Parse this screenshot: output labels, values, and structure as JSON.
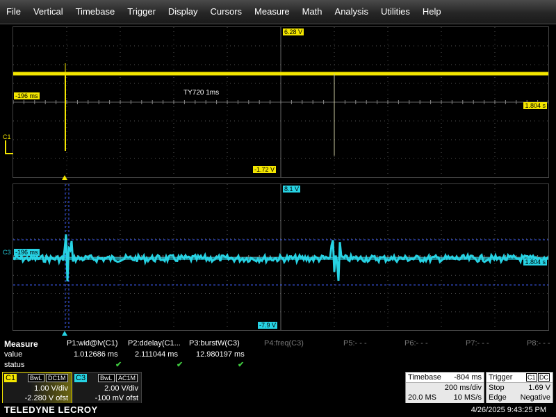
{
  "menu": [
    "File",
    "Vertical",
    "Timebase",
    "Trigger",
    "Display",
    "Cursors",
    "Measure",
    "Math",
    "Analysis",
    "Utilities",
    "Help"
  ],
  "grid1": {
    "top_label": "6.28 V",
    "bottom_label": "-1.72 V",
    "left_label": "-196 ms",
    "right_label": "1.804 s",
    "channel_marker": "C1",
    "annotation": "TY720 1ms",
    "trace_color": "#f4e600"
  },
  "grid2": {
    "top_label": "8.1 V",
    "bottom_label": "-7.9 V",
    "left_label": "-196 ms",
    "right_label": "1.804 s",
    "channel_marker": "C3",
    "trace_color": "#27d3e4"
  },
  "measure": {
    "title": "Measure",
    "row_value": "value",
    "row_status": "status",
    "params": [
      {
        "name": "P1:wid@lv(C1)",
        "value": "1.012686 ms",
        "status": "✔",
        "active": true
      },
      {
        "name": "P2:ddelay(C1...",
        "value": "2.111044 ms",
        "status": "✔",
        "active": true
      },
      {
        "name": "P3:burstW(C3)",
        "value": "12.980197 ms",
        "status": "✔",
        "active": true
      },
      {
        "name": "P4:freq(C3)",
        "value": "",
        "status": "",
        "active": false
      },
      {
        "name": "P5:- - -",
        "value": "",
        "status": "",
        "active": false
      },
      {
        "name": "P6:- - -",
        "value": "",
        "status": "",
        "active": false
      },
      {
        "name": "P7:- - -",
        "value": "",
        "status": "",
        "active": false
      },
      {
        "name": "P8:- - -",
        "value": "",
        "status": "",
        "active": false
      }
    ]
  },
  "c1": {
    "tag": "C1",
    "bw": "BwL",
    "coupling": "DC1M",
    "vdiv": "1.00 V/div",
    "offset": "-2.280 V ofst",
    "color": "#f4e600"
  },
  "c3": {
    "tag": "C3",
    "bw": "BwL",
    "coupling": "AC1M",
    "vdiv": "2.00 V/div",
    "offset": "-100 mV ofst",
    "color": "#27d3e4"
  },
  "timebase": {
    "label": "Timebase",
    "delay": "-804 ms",
    "tdiv": "200 ms/div",
    "samples": "20.0 MS",
    "rate": "10 MS/s"
  },
  "trigger": {
    "label": "Trigger",
    "source": "C1",
    "coupling": "DC",
    "mode": "Stop",
    "level": "1.69 V",
    "type": "Edge",
    "slope": "Negative"
  },
  "footer": {
    "brand": "TELEDYNE LECROY",
    "timestamp": "4/26/2025 9:43:25 PM"
  }
}
